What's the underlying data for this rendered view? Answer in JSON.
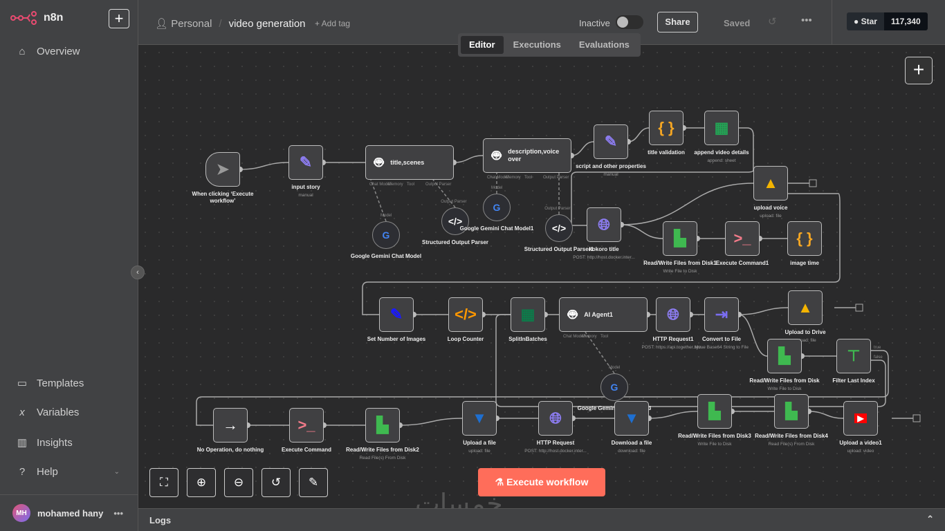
{
  "app": {
    "name": "n8n",
    "new_label": "+"
  },
  "sidebar": {
    "items": [
      {
        "label": "Overview",
        "icon": "home-icon"
      },
      {
        "label": "Templates",
        "icon": "box-icon"
      },
      {
        "label": "Variables",
        "icon": "variable-icon"
      },
      {
        "label": "Insights",
        "icon": "chart-icon"
      },
      {
        "label": "Help",
        "icon": "question-icon"
      }
    ],
    "user": {
      "initials": "MH",
      "name": "mohamed hany",
      "more": "•••"
    }
  },
  "header": {
    "project": "Personal",
    "workflow": "video generation",
    "add_tag": "+ Add tag",
    "status": "Inactive",
    "share": "Share",
    "saved": "Saved",
    "more": "•••",
    "github_star": "Star",
    "github_count": "117,340"
  },
  "tabs": [
    {
      "label": "Editor",
      "active": true
    },
    {
      "label": "Executions"
    },
    {
      "label": "Evaluations"
    }
  ],
  "canvas": {
    "execute_label": "Execute workflow",
    "logs_label": "Logs",
    "watermark": "خمسات"
  },
  "nodes": [
    {
      "id": "trigger",
      "label": "When clicking ‘Execute workflow’",
      "icon": "cursor-icon"
    },
    {
      "id": "input",
      "label": "input story",
      "sub": "manual",
      "icon": "pencil-icon"
    },
    {
      "id": "agent1",
      "label": "title,scenes",
      "icon": "robot-icon",
      "ports": [
        "Chat Model",
        "Memory",
        "Tool",
        "Output Parser"
      ]
    },
    {
      "id": "agent2",
      "label": "description,voice over",
      "icon": "robot-icon",
      "ports": [
        "Chat Model",
        "Memory",
        "Tool",
        "Output Parser"
      ]
    },
    {
      "id": "script",
      "label": "script and other properties",
      "sub": "manual",
      "icon": "pencil-icon"
    },
    {
      "id": "titleval",
      "label": "title validation",
      "icon": "braces-icon"
    },
    {
      "id": "append",
      "label": "append video details",
      "sub": "append: sheet",
      "icon": "sheets-icon"
    },
    {
      "id": "upvoice",
      "label": "upload voice",
      "sub": "upload: file",
      "icon": "drive-icon"
    },
    {
      "id": "gem0",
      "label": "Google Gemini Chat Model",
      "icon": "google-icon",
      "port": "Model"
    },
    {
      "id": "sop0",
      "label": "Structured Output Parser",
      "icon": "code-icon",
      "port": "Output Parser"
    },
    {
      "id": "gem1",
      "label": "Google Gemini Chat Model1",
      "icon": "google-icon",
      "port": "Model"
    },
    {
      "id": "sop1",
      "label": "Structured Output Parser1",
      "icon": "code-icon",
      "port": "Output Parser"
    },
    {
      "id": "kokoro",
      "label": "kokoro title",
      "sub": "POST: http://host.docker.inter...",
      "icon": "globe-icon"
    },
    {
      "id": "rw1",
      "label": "Read/Write Files from Disk1",
      "sub": "Write File to Disk",
      "icon": "file-disk-icon"
    },
    {
      "id": "exec1",
      "label": "Execute Command1",
      "icon": "terminal-icon"
    },
    {
      "id": "imgtime",
      "label": "image time",
      "icon": "braces-icon"
    },
    {
      "id": "setnum",
      "label": "Set Number of Images",
      "icon": "pencil-blue-icon"
    },
    {
      "id": "loop",
      "label": "Loop Counter",
      "icon": "code-orange-icon"
    },
    {
      "id": "split",
      "label": "SplitInBatches",
      "icon": "grid-icon"
    },
    {
      "id": "agent3",
      "label": "AI Agent1",
      "icon": "robot-icon",
      "ports": [
        "Chat Model*",
        "Memory",
        "Tool"
      ]
    },
    {
      "id": "http1",
      "label": "HTTP Request1",
      "sub": "POST: https://api.together.xyz...",
      "icon": "globe-icon"
    },
    {
      "id": "convert",
      "label": "Convert to File",
      "sub": "Move Base64 String to File",
      "icon": "convert-icon"
    },
    {
      "id": "updrive",
      "label": "Upload to Drive",
      "sub": "upload: file",
      "icon": "drive-icon"
    },
    {
      "id": "rw0",
      "label": "Read/Write Files from Disk",
      "sub": "Write File to Disk",
      "icon": "file-disk-icon"
    },
    {
      "id": "filter",
      "label": "Filter Last Index",
      "icon": "signpost-icon",
      "outputs": [
        "true",
        "false"
      ]
    },
    {
      "id": "gem3",
      "label": "Google Gemini Chat Model3",
      "icon": "google-icon",
      "port": "Model"
    },
    {
      "id": "noop",
      "label": "No Operation, do nothing",
      "icon": "arrow-right-icon"
    },
    {
      "id": "exec0",
      "label": "Execute Command",
      "icon": "terminal-icon"
    },
    {
      "id": "rw2",
      "label": "Read/Write Files from Disk2",
      "sub": "Read File(s) From Disk",
      "icon": "file-disk-icon"
    },
    {
      "id": "upfile",
      "label": "Upload a file",
      "sub": "upload: file",
      "icon": "bucket-icon"
    },
    {
      "id": "http0",
      "label": "HTTP Request",
      "sub": "POST: http://host.docker.inter...",
      "icon": "globe-icon"
    },
    {
      "id": "download",
      "label": "Download a file",
      "sub": "download: file",
      "icon": "bucket-icon"
    },
    {
      "id": "rw3",
      "label": "Read/Write Files from Disk3",
      "sub": "Write File to Disk",
      "icon": "file-disk-icon"
    },
    {
      "id": "rw4",
      "label": "Read/Write Files from Disk4",
      "sub": "Read File(s) From Disk",
      "icon": "file-disk-icon"
    },
    {
      "id": "upvideo",
      "label": "Upload a video1",
      "sub": "upload: video",
      "icon": "youtube-icon"
    }
  ],
  "connections": [
    [
      "trigger",
      "input"
    ],
    [
      "input",
      "agent1"
    ],
    [
      "agent1",
      "agent2"
    ],
    [
      "agent2",
      "script"
    ],
    [
      "script",
      "titleval"
    ],
    [
      "titleval",
      "append"
    ],
    [
      "kokoro",
      "upvoice"
    ],
    [
      "kokoro",
      "rw1"
    ],
    [
      "rw1",
      "exec1"
    ],
    [
      "exec1",
      "imgtime"
    ],
    [
      "setnum",
      "loop"
    ],
    [
      "loop",
      "split"
    ],
    [
      "split",
      "agent3"
    ],
    [
      "agent3",
      "http1"
    ],
    [
      "http1",
      "convert"
    ],
    [
      "convert",
      "updrive"
    ],
    [
      "convert",
      "rw0"
    ],
    [
      "rw0",
      "filter"
    ],
    [
      "noop",
      "exec0"
    ],
    [
      "exec0",
      "rw2"
    ],
    [
      "rw2",
      "upfile"
    ],
    [
      "upfile",
      "http0"
    ],
    [
      "http0",
      "download"
    ],
    [
      "download",
      "rw3"
    ],
    [
      "rw3",
      "rw4"
    ],
    [
      "rw4",
      "upvideo"
    ]
  ],
  "colors": {
    "accent": "#ff6d5a",
    "canvas": "#2a2a2b",
    "node": "#404042"
  }
}
